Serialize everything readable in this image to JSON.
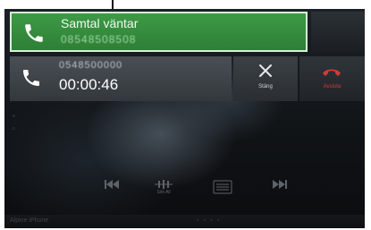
{
  "waiting_call": {
    "title": "Samtal väntar",
    "number": "08548508508"
  },
  "active_call": {
    "number": "0548500000",
    "timer": "00:00:46"
  },
  "buttons": {
    "close_label": "Stäng",
    "end_label": "Avsluta"
  },
  "controls": {
    "search_all_label": "Sök All"
  },
  "footer": {
    "source_label": "Alpine iPhone"
  },
  "colors": {
    "waiting_banner": "#3d9a45",
    "end_call": "#d23a3a"
  }
}
